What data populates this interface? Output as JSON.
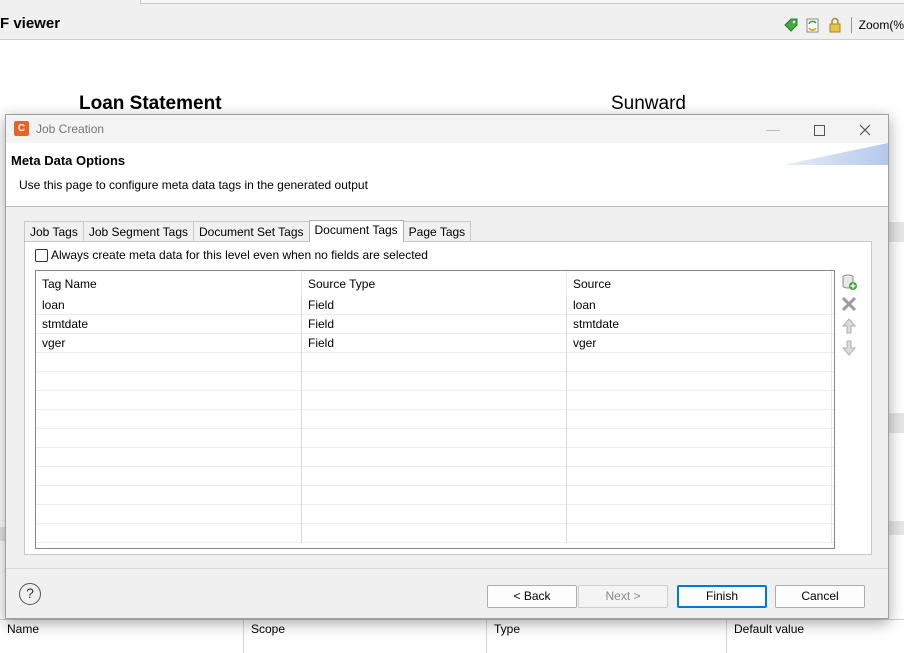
{
  "background": {
    "app_title": "F viewer",
    "zoom_label": "Zoom(%",
    "doc_title": "Loan Statement",
    "doc_company": "Sunward",
    "bottom_table_headers": [
      "Name",
      "Scope",
      "Type",
      "Default value"
    ]
  },
  "dialog": {
    "title": "Job Creation",
    "page_title": "Meta Data Options",
    "page_description": "Use this page to configure meta data tags in the generated output",
    "tabs": [
      {
        "label": "Job Tags",
        "active": false
      },
      {
        "label": "Job Segment Tags",
        "active": false
      },
      {
        "label": "Document Set Tags",
        "active": false
      },
      {
        "label": "Document Tags",
        "active": true
      },
      {
        "label": "Page Tags",
        "active": false
      }
    ],
    "checkbox_label": "Always create meta data for this level even when no fields are selected",
    "checkbox_checked": false,
    "table": {
      "columns": [
        "Tag Name",
        "Source Type",
        "Source"
      ],
      "rows": [
        [
          "loan",
          "Field",
          "loan"
        ],
        [
          "stmtdate",
          "Field",
          "stmtdate"
        ],
        [
          "vger",
          "Field",
          "vger"
        ]
      ],
      "empty_rows": 10
    },
    "buttons": {
      "back": "< Back",
      "next": "Next >",
      "finish": "Finish",
      "cancel": "Cancel"
    },
    "help_symbol": "?"
  }
}
